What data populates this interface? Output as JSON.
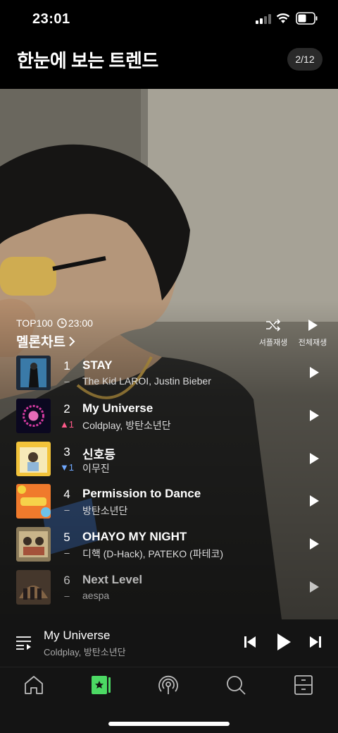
{
  "status_bar": {
    "time": "23:01"
  },
  "header": {
    "title": "한눈에 보는 트렌드",
    "counter": "2/12"
  },
  "chart": {
    "label": "TOP100",
    "update_time": "23:00",
    "title": "멜론차트",
    "shuffle_label": "셔플재생",
    "play_all_label": "전체재생"
  },
  "tracks": [
    {
      "rank": "1",
      "change": "–",
      "title": "STAY",
      "artist": "The Kid LAROI, Justin Bieber"
    },
    {
      "rank": "2",
      "change": "▲1",
      "title": "My Universe",
      "artist": "Coldplay, 방탄소년단"
    },
    {
      "rank": "3",
      "change": "▼1",
      "title": "신호등",
      "artist": "이무진"
    },
    {
      "rank": "4",
      "change": "–",
      "title": "Permission to Dance",
      "artist": "방탄소년단"
    },
    {
      "rank": "5",
      "change": "–",
      "title": "OHAYO MY NIGHT",
      "artist": "디핵 (D-Hack), PATEKO (파테코)"
    },
    {
      "rank": "6",
      "change": "–",
      "title": "Next Level",
      "artist": "aespa"
    }
  ],
  "now_playing": {
    "title": "My Universe",
    "artist": "Coldplay, 방탄소년단"
  },
  "tabs": [
    "home-icon",
    "chart-icon",
    "radio-icon",
    "search-icon",
    "library-icon"
  ],
  "colors": {
    "accent": "#4cd964",
    "rank_up": "#ff5a8a",
    "rank_down": "#6fa8ff"
  }
}
